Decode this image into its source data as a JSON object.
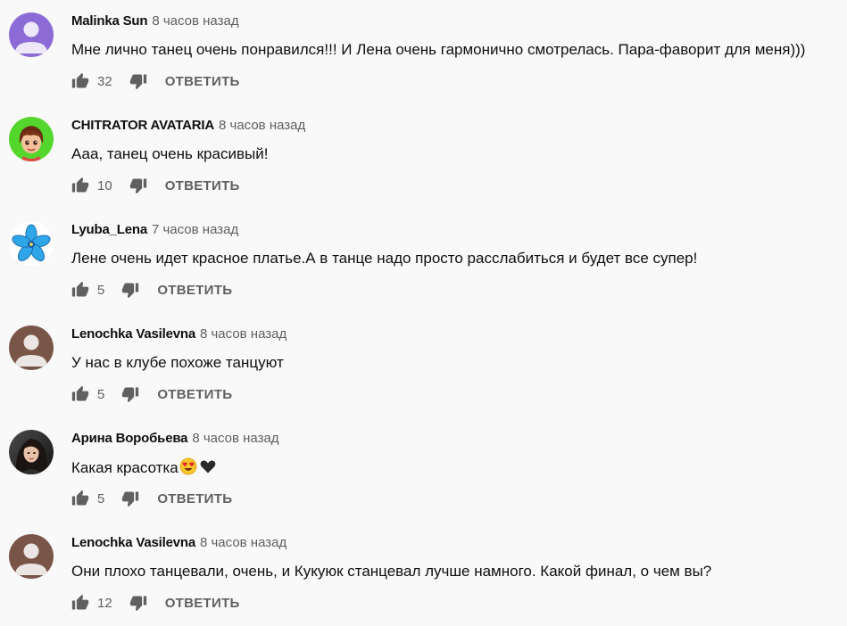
{
  "comments": [
    {
      "author": "Malinka Sun",
      "time": "8 часов назад",
      "text": "Мне лично танец очень понравился!!! И Лена очень гармонично смотрелась. Пара-фаворит для меня)))",
      "likes": "32",
      "reply": "ОТВЕТИТЬ",
      "avatar_icon": "default-avatar-icon",
      "avatar_color": "#8c6bd6"
    },
    {
      "author": "CHITRATOR AVATARIA",
      "time": "8 часов назад",
      "text": "Ааа, танец очень красивый!",
      "likes": "10",
      "reply": "ОТВЕТИТЬ",
      "avatar_icon": "cartoon-character-avatar",
      "avatar_color": "#54d62c"
    },
    {
      "author": "Lyuba_Lena",
      "time": "7 часов назад",
      "text": "Лене очень идет красное платье.А в танце надо просто расслабиться и будет все супер!",
      "likes": "5",
      "reply": "ОТВЕТИТЬ",
      "avatar_icon": "blue-flower-avatar",
      "avatar_color": "#2fa6e8"
    },
    {
      "author": "Lenochka Vasilevna",
      "time": "8 часов назад",
      "text": "У нас в клубе похоже танцуют",
      "likes": "5",
      "reply": "ОТВЕТИТЬ",
      "avatar_icon": "default-avatar-icon",
      "avatar_color": "#795548"
    },
    {
      "author": "Арина Воробьева",
      "time": "8 часов назад",
      "text": "Какая красотка",
      "emojis": [
        "heart-eyes-emoji",
        "black-heart-emoji"
      ],
      "likes": "5",
      "reply": "ОТВЕТИТЬ",
      "avatar_icon": "photo-avatar",
      "avatar_color": "#2b2b2b"
    },
    {
      "author": "Lenochka Vasilevna",
      "time": "8 часов назад",
      "text": "Они плохо танцевали, очень, и Кукуюк станцевал лучше намного. Какой финал, о чем вы?",
      "likes": "12",
      "reply": "ОТВЕТИТЬ",
      "avatar_icon": "default-avatar-icon",
      "avatar_color": "#795548"
    }
  ]
}
